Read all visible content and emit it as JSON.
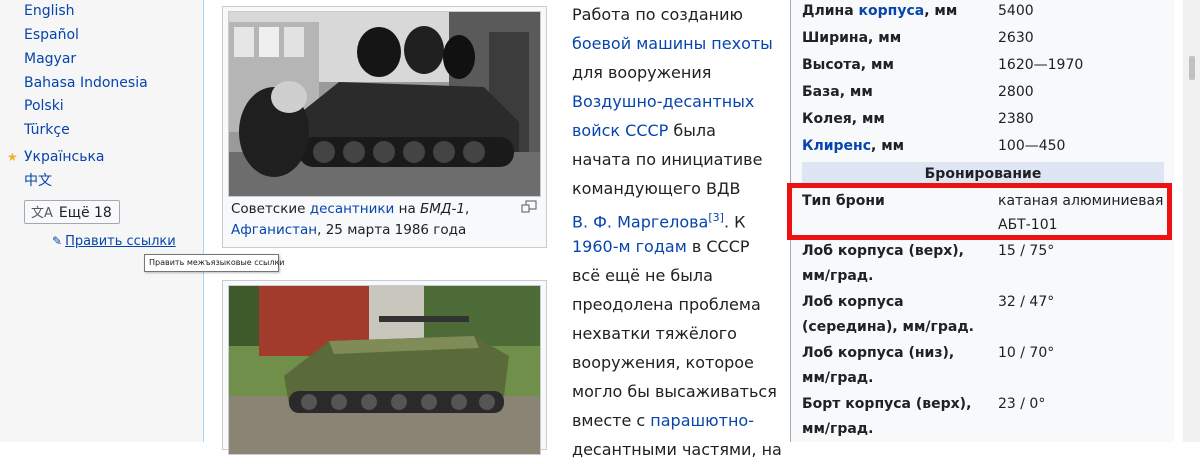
{
  "sidebar": {
    "languages": [
      {
        "label": "English",
        "star": false
      },
      {
        "label": "Español",
        "star": false
      },
      {
        "label": "Magyar",
        "star": false
      },
      {
        "label": "Bahasa Indonesia",
        "star": false
      },
      {
        "label": "Polski",
        "star": false
      },
      {
        "label": "Türkçe",
        "star": false
      },
      {
        "label": "Українська",
        "star": true
      },
      {
        "label": "中文",
        "star": false
      }
    ],
    "more_label": "Ещё 18",
    "more_glyph": "文A",
    "edit_links_label": "Править ссылки",
    "tooltip": "Править межъязыковые ссылки"
  },
  "thumb1": {
    "caption_a": "Советские ",
    "caption_link1": "десантники",
    "caption_b": " на ",
    "caption_italic": "БМД-1",
    "caption_c": ",",
    "caption_link2": "Афганистан",
    "caption_d": ", 25 марта 1986 года"
  },
  "article": {
    "l1": "Работа по созданию",
    "l2": "боевой машины пехоты",
    "l3": "для вооружения",
    "l4": "Воздушно-десантных",
    "l5_link": "войск СССР",
    "l5_text": " была",
    "l6": "начата по инициативе",
    "l7": "командующего ВДВ",
    "l8_link": "В. Ф. Маргелова",
    "l8_ref": "[3]",
    "l8_text": ". К",
    "l9_link": "1960-м годам",
    "l9_text": " в СССР",
    "l10": "всё ещё не была",
    "l11": "преодолена проблема",
    "l12": "нехватки тяжёлого",
    "l13": "вооружения, которое",
    "l14": "могло бы высаживаться",
    "l15_text": "вместе с ",
    "l15_link": "парашютно-",
    "l16": "десантными частями, на"
  },
  "infobox": {
    "dims": [
      {
        "label_pre": "Длина ",
        "label_link": "корпуса",
        "label_post": ", мм",
        "value": "5400"
      },
      {
        "label_pre": "Ширина, мм",
        "label_link": "",
        "label_post": "",
        "value": "2630"
      },
      {
        "label_pre": "Высота, мм",
        "label_link": "",
        "label_post": "",
        "value": "1620—1970"
      },
      {
        "label_pre": "База, мм",
        "label_link": "",
        "label_post": "",
        "value": "2800"
      },
      {
        "label_pre": "Колея, мм",
        "label_link": "",
        "label_post": "",
        "value": "2380"
      },
      {
        "label_pre": "",
        "label_link": "Клиренс",
        "label_post": ", мм",
        "value": "100—450"
      }
    ],
    "section_title": "Бронирование",
    "armor_type_label": "Тип брони",
    "armor_type_value_l1": "катаная алюминиевая",
    "armor_type_value_l2": "АБТ-101",
    "armor": [
      {
        "l1": "Лоб корпуса (верх),",
        "l2": "мм/град.",
        "value": "15 / 75°"
      },
      {
        "l1": "Лоб корпуса",
        "l2": "(середина), мм/град.",
        "value": "32 / 47°"
      },
      {
        "l1": "Лоб корпуса (низ),",
        "l2": "мм/град.",
        "value": "10 / 70°"
      },
      {
        "l1": "Борт корпуса (верх),",
        "l2": "мм/град.",
        "value": "23 / 0°"
      }
    ]
  }
}
